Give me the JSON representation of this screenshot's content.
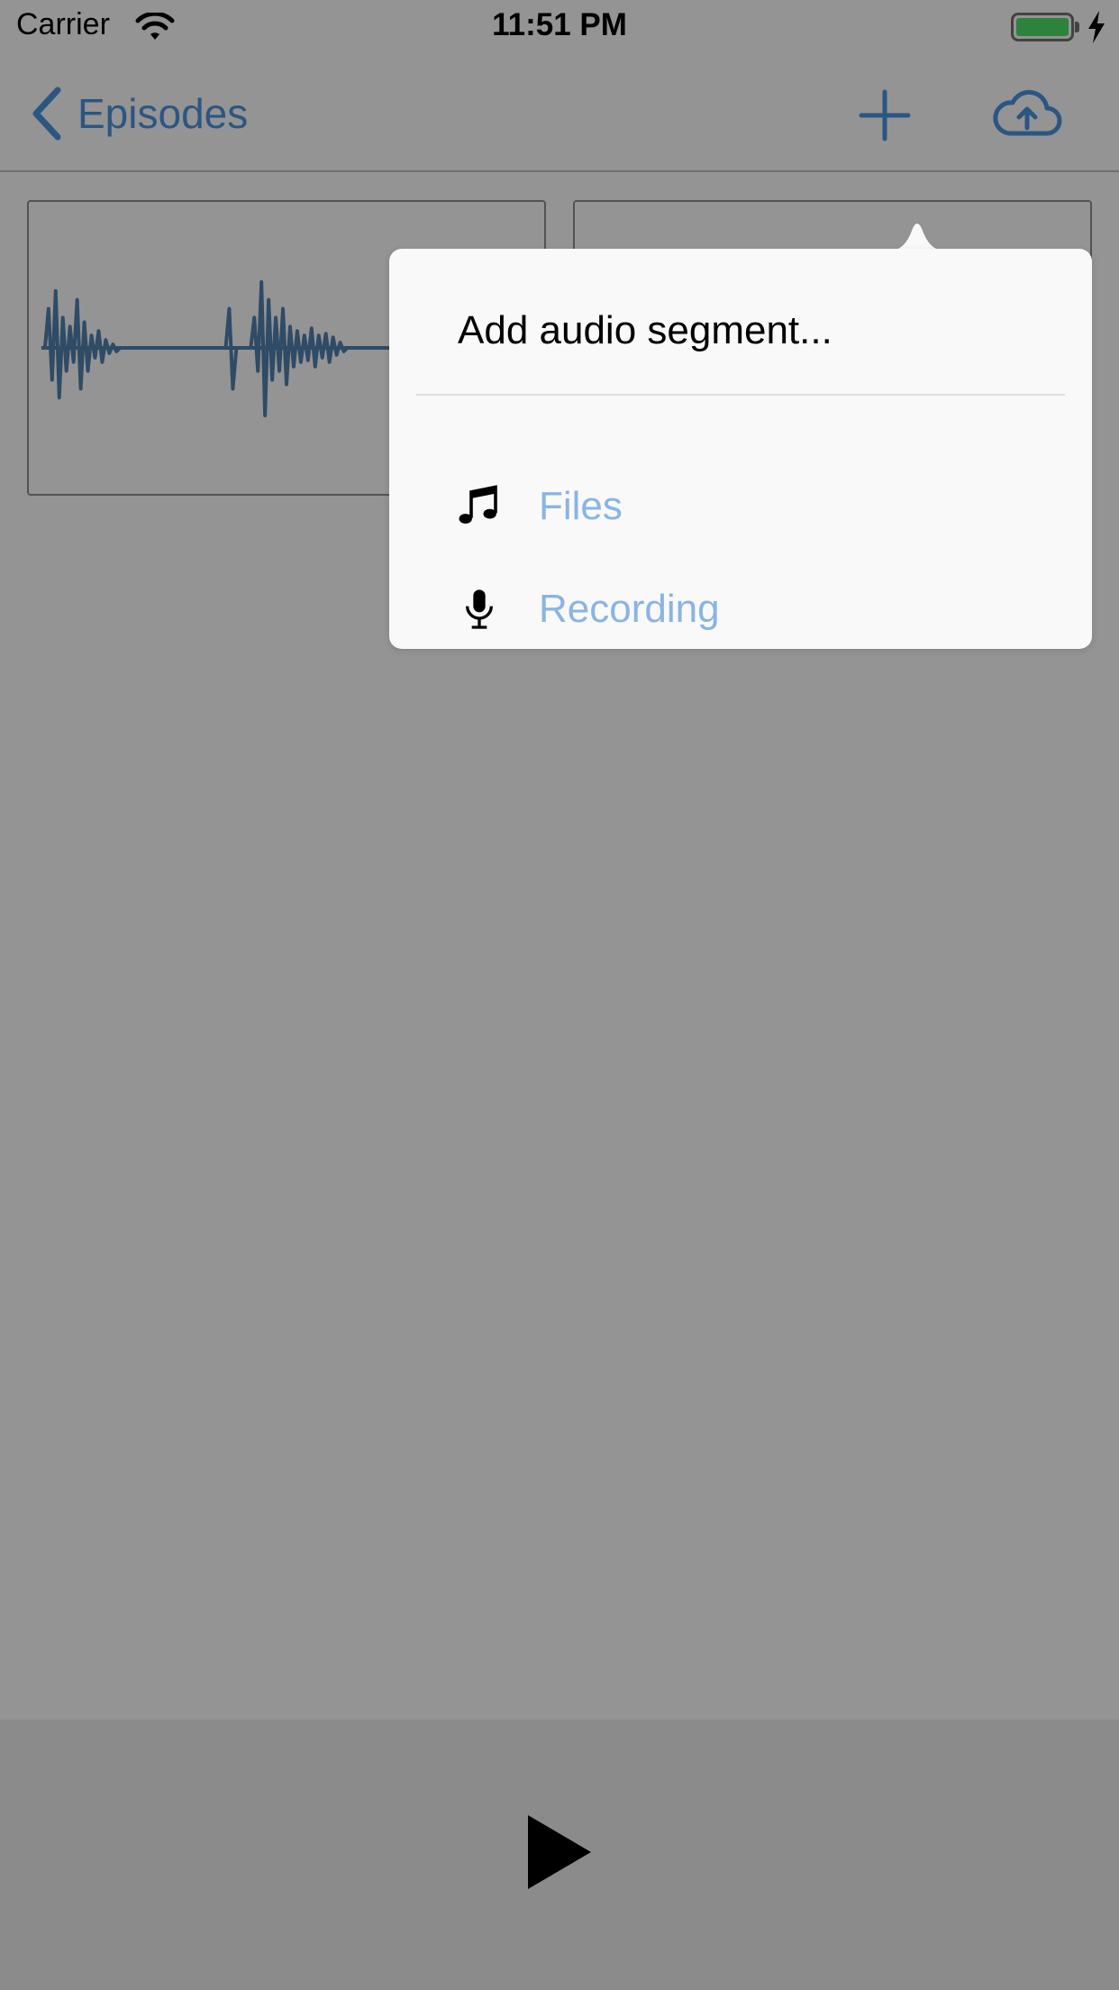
{
  "status_bar": {
    "carrier": "Carrier",
    "time": "11:51 PM",
    "battery_color": "#4cd964"
  },
  "nav": {
    "back_label": "Episodes",
    "accent_color": "#4a90d9",
    "add_icon": "plus-icon",
    "upload_icon": "cloud-upload-icon"
  },
  "segments": [
    {
      "name": "audio-segment-1",
      "icon": "waveform"
    },
    {
      "name": "audio-segment-2",
      "icon": "waveform"
    }
  ],
  "popover": {
    "title": "Add audio segment...",
    "items": [
      {
        "label": "Files",
        "icon": "music-note-icon"
      },
      {
        "label": "Recording",
        "icon": "microphone-icon"
      }
    ]
  },
  "player": {
    "play_icon": "play-icon"
  }
}
